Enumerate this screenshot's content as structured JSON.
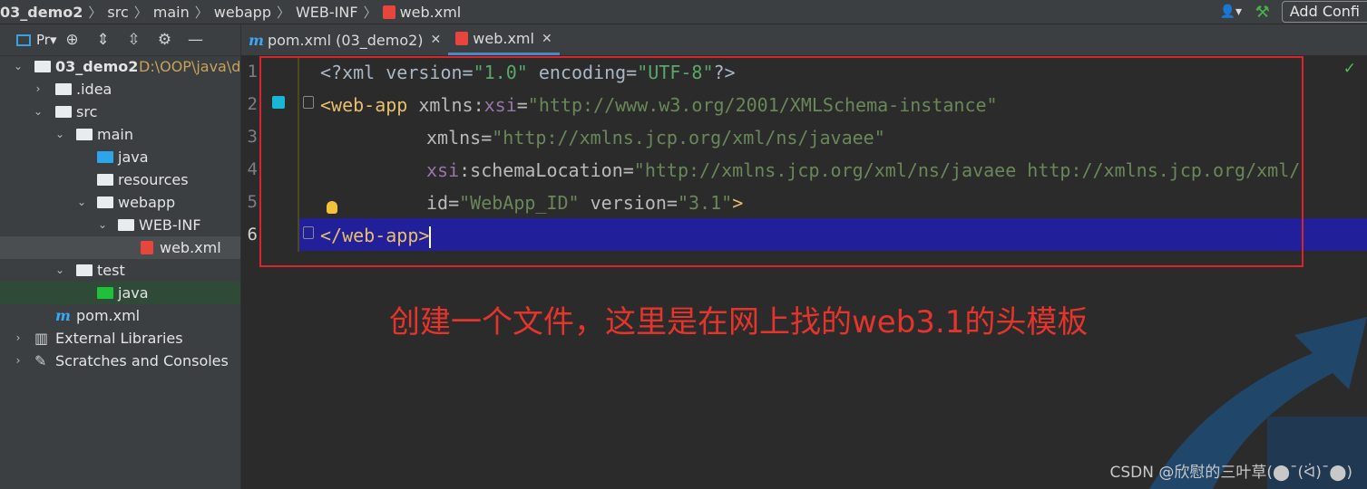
{
  "navbar": {
    "crumbs": [
      "03_demo2",
      "src",
      "main",
      "webapp",
      "WEB-INF",
      "web.xml"
    ],
    "add_config_label": "Add Confi"
  },
  "project_panel": {
    "view_label": "Pr▾",
    "tree": [
      {
        "label": "03_demo2",
        "hint": "D:\\OOP\\java\\d"
      },
      {
        "label": ".idea"
      },
      {
        "label": "src"
      },
      {
        "label": "main"
      },
      {
        "label": "java"
      },
      {
        "label": "resources"
      },
      {
        "label": "webapp"
      },
      {
        "label": "WEB-INF"
      },
      {
        "label": "web.xml"
      },
      {
        "label": "test"
      },
      {
        "label": "java"
      },
      {
        "label": "pom.xml"
      },
      {
        "label": "External Libraries"
      },
      {
        "label": "Scratches and Consoles"
      }
    ]
  },
  "tabs": [
    {
      "label": "pom.xml (03_demo2)",
      "icon": "maven-icon"
    },
    {
      "label": "web.xml",
      "icon": "xml-file-icon",
      "active": true
    }
  ],
  "editor": {
    "line_numbers": [
      "1",
      "2",
      "3",
      "4",
      "5",
      "6"
    ],
    "lines": {
      "l1": {
        "p1": "<?xml version=",
        "p2": "\"1.0\"",
        "p3": " encoding=",
        "p4": "\"UTF-8\"",
        "p5": "?>"
      },
      "l2": {
        "tag": "<web-app",
        "attr": " xmlns:",
        "ns": "xsi",
        "eq": "=",
        "val": "\"http://www.w3.org/2001/XMLSchema-instance\""
      },
      "l3": {
        "attr": "xmlns",
        "eq": "=",
        "val": "\"http://xmlns.jcp.org/xml/ns/javaee\""
      },
      "l4": {
        "ns": "xsi",
        "attr": ":schemaLocation",
        "eq": "=",
        "val": "\"http://xmlns.jcp.org/xml/ns/javaee http://xmlns.jcp.org/xml/"
      },
      "l5": {
        "attr": "id",
        "eq": "=",
        "val": "\"WebApp_ID\"",
        "attr2": " version",
        "eq2": "=",
        "val2": "\"3.1\"",
        "end": ">"
      },
      "l6": {
        "tag": "</web-app>"
      }
    },
    "annotation": "创建一个文件，这里是在网上找的web3.1的头模板",
    "watermark": "CSDN @欣慰的三叶草(⬤¯(ᐛ)¯⬤)"
  },
  "colors": {
    "accent_red": "#d8242b",
    "current_line": "#21209a",
    "xml_tag": "#e8bf6a",
    "xml_string": "#6a8759"
  }
}
